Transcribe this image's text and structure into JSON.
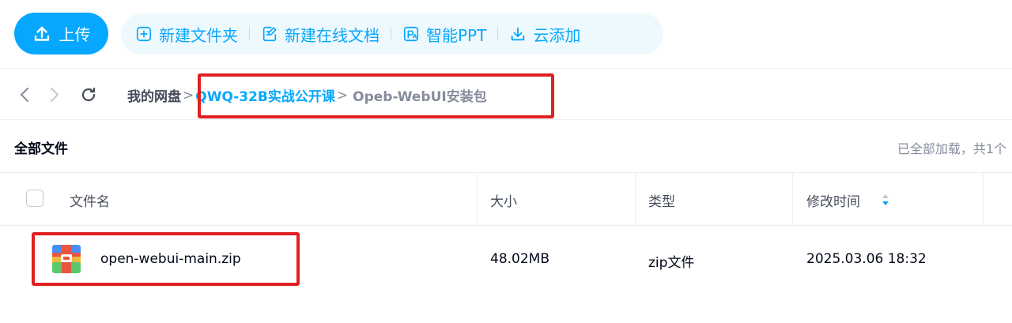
{
  "toolbar": {
    "upload_label": "上传",
    "new_folder_label": "新建文件夹",
    "new_doc_label": "新建在线文档",
    "smart_ppt_label": "智能PPT",
    "cloud_add_label": "云添加"
  },
  "breadcrumb": {
    "root": "我的网盘",
    "separator": ">",
    "items": [
      "QWQ-32B实战公开课",
      "Opeb-WebUI安装包"
    ]
  },
  "section": {
    "title": "全部文件",
    "load_status": "已全部加载，共1个"
  },
  "table": {
    "headers": {
      "name": "文件名",
      "size": "大小",
      "type": "类型",
      "modified": "修改时间"
    },
    "rows": [
      {
        "name": "open-webui-main.zip",
        "size": "48.02MB",
        "type": "zip文件",
        "modified": "2025.03.06 18:32",
        "icon": "zip-file-icon"
      }
    ]
  },
  "colors": {
    "accent": "#06a7ff",
    "highlight_box": "#e02020"
  }
}
